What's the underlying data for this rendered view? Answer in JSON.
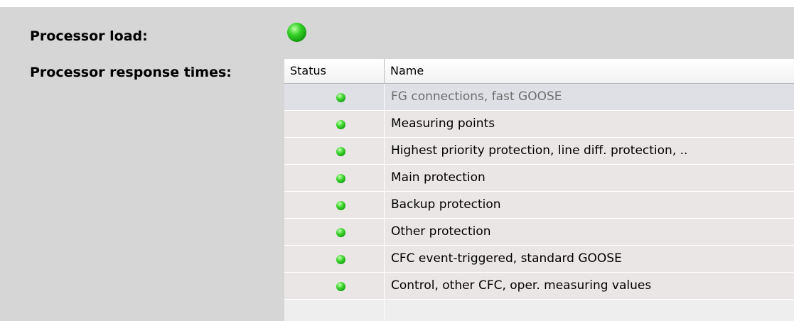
{
  "processor_load": {
    "label": "Processor load:",
    "status": "ok",
    "status_color": "#22c21a"
  },
  "processor_response_times": {
    "label": "Processor response times:",
    "columns": [
      "Status",
      "Name"
    ],
    "rows": [
      {
        "status": "ok",
        "name": "FG connections, fast GOOSE",
        "selected": true
      },
      {
        "status": "ok",
        "name": "Measuring points"
      },
      {
        "status": "ok",
        "name": "Highest priority protection, line diff. protection, .."
      },
      {
        "status": "ok",
        "name": "Main protection"
      },
      {
        "status": "ok",
        "name": "Backup protection"
      },
      {
        "status": "ok",
        "name": "Other protection"
      },
      {
        "status": "ok",
        "name": "CFC event-triggered, standard GOOSE"
      },
      {
        "status": "ok",
        "name": "Control, other CFC, oper. measuring values"
      }
    ]
  },
  "colors": {
    "background": "#d6d6d6",
    "row_background": "#ebe6e6",
    "selected_row": "#dfdfe6",
    "status_ok": "#22c21a"
  }
}
